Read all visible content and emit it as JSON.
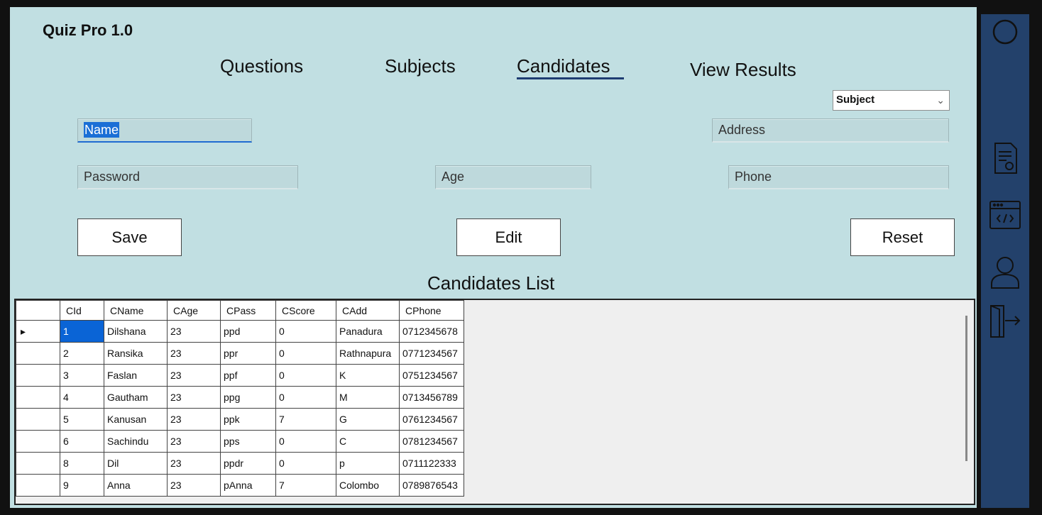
{
  "app": {
    "title": "Quiz Pro 1.0"
  },
  "nav": {
    "questions": "Questions",
    "subjects": "Subjects",
    "candidates": "Candidates",
    "view_results": "View Results"
  },
  "subject_dropdown": {
    "selected": "Subject"
  },
  "form": {
    "name_placeholder": "Name",
    "address_placeholder": "Address",
    "password_placeholder": "Password",
    "age_placeholder": "Age",
    "phone_placeholder": "Phone"
  },
  "buttons": {
    "save": "Save",
    "edit": "Edit",
    "reset": "Reset"
  },
  "list": {
    "title": "Candidates List",
    "columns": [
      "CId",
      "CName",
      "CAge",
      "CPass",
      "CScore",
      "CAdd",
      "CPhone"
    ],
    "rows": [
      [
        "1",
        "Dilshana",
        "23",
        "ppd",
        "0",
        "Panadura",
        "0712345678"
      ],
      [
        "2",
        "Ransika",
        "23",
        "ppr",
        "0",
        "Rathnapura",
        "0771234567"
      ],
      [
        "3",
        "Faslan",
        "23",
        "ppf",
        "0",
        "K",
        "0751234567"
      ],
      [
        "4",
        "Gautham",
        "23",
        "ppg",
        "0",
        "M",
        "0713456789"
      ],
      [
        "5",
        "Kanusan",
        "23",
        "ppk",
        "7",
        "G",
        "0761234567"
      ],
      [
        "6",
        "Sachindu",
        "23",
        "pps",
        "0",
        "C",
        "0781234567"
      ],
      [
        "8",
        "Dil",
        "23",
        "ppdr",
        "0",
        "p",
        "0711122333"
      ],
      [
        "9",
        "Anna",
        "23",
        "pAnna",
        "7",
        "Colombo",
        "0789876543"
      ]
    ]
  },
  "sidebar": {
    "icons": [
      "circle-icon",
      "document-icon",
      "code-window-icon",
      "user-icon",
      "logout-icon"
    ]
  },
  "colors": {
    "panel": "#c1dfe2",
    "sidebar": "#23416b",
    "accent": "#0a64d6"
  }
}
